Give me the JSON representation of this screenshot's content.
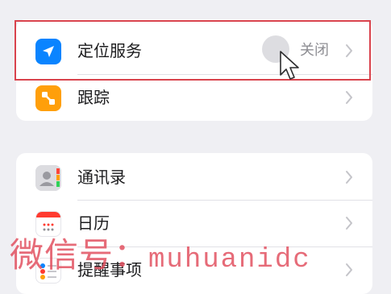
{
  "settings_group_1": {
    "items": [
      {
        "label": "定位服务",
        "value": "关闭",
        "icon": "location-arrow-icon",
        "icon_color": "#0a84ff"
      },
      {
        "label": "跟踪",
        "value": "",
        "icon": "tracking-icon",
        "icon_color": "#ff9f0a"
      }
    ]
  },
  "settings_group_2": {
    "items": [
      {
        "label": "通讯录",
        "icon": "contacts-icon"
      },
      {
        "label": "日历",
        "icon": "calendar-icon"
      },
      {
        "label": "提醒事项",
        "icon": "reminders-icon"
      }
    ]
  },
  "highlight": {
    "color": "#d9434d"
  },
  "watermark": {
    "cjk": "微信号：",
    "latin": "muhuanidc"
  }
}
